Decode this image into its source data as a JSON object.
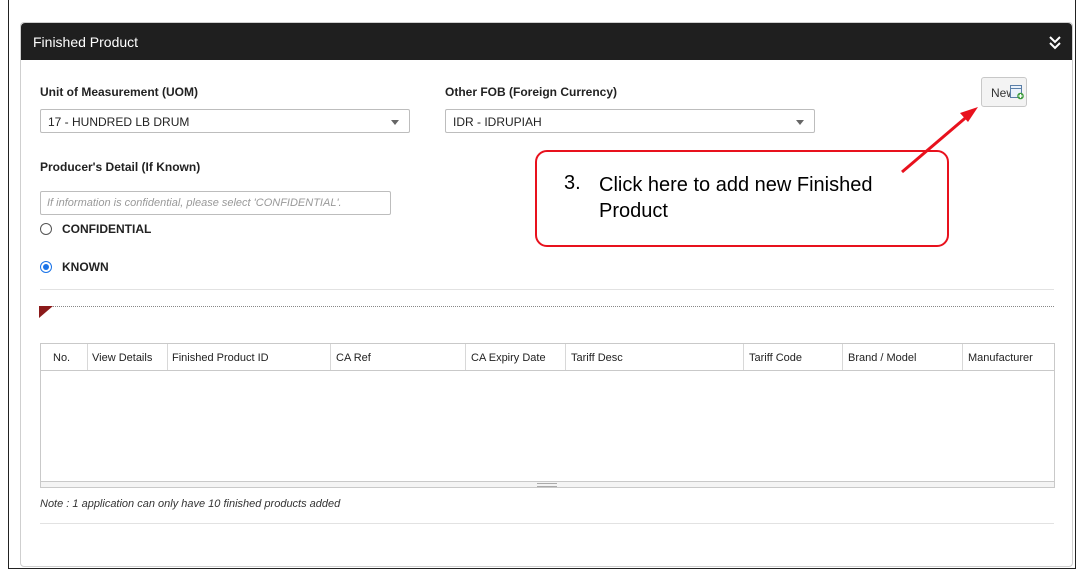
{
  "panel": {
    "title": "Finished Product",
    "collapse_icon": "double-chevron-down-icon"
  },
  "form": {
    "uom_label": "Unit of Measurement (UOM)",
    "uom_value": "17 - HUNDRED LB DRUM",
    "fob_label": "Other FOB (Foreign Currency)",
    "fob_value": "IDR - IDRUPIAH",
    "producer_label": "Producer's Detail (If Known)",
    "producer_placeholder": "If information is confidential, please select 'CONFIDENTIAL'.",
    "producer_value": "",
    "radio_confidential": "CONFIDENTIAL",
    "radio_known": "KNOWN",
    "selected_radio": "KNOWN"
  },
  "toolbar": {
    "new_label": "New",
    "new_icon": "new-document-icon"
  },
  "table": {
    "columns": [
      "No.",
      "View Details",
      "Finished Product ID",
      "CA Ref",
      "CA Expiry Date",
      "Tariff Desc",
      "Tariff Code",
      "Brand / Model",
      "Manufacturer"
    ],
    "rows": []
  },
  "note": "Note : 1 application can only have 10 finished products added",
  "callout": {
    "number": "3.",
    "text": "Click here to add new Finished Product",
    "color": "#e8111d"
  }
}
